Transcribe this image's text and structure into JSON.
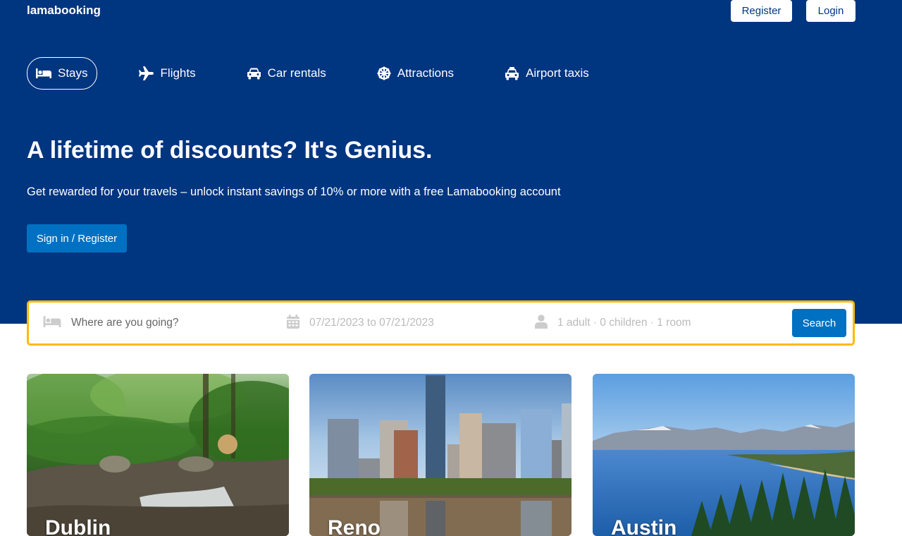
{
  "app": {
    "logo": "lamabooking"
  },
  "nav": {
    "register_label": "Register",
    "login_label": "Login"
  },
  "tabs": [
    {
      "label": "Stays",
      "icon": "bed-icon",
      "active": true
    },
    {
      "label": "Flights",
      "icon": "plane-icon",
      "active": false
    },
    {
      "label": "Car rentals",
      "icon": "car-icon",
      "active": false
    },
    {
      "label": "Attractions",
      "icon": "attraction-icon",
      "active": false
    },
    {
      "label": "Airport taxis",
      "icon": "taxi-icon",
      "active": false
    }
  ],
  "hero": {
    "title": "A lifetime of discounts? It's Genius.",
    "description": "Get rewarded for your travels – unlock instant savings of 10% or more with a free Lamabooking account",
    "cta_label": "Sign in / Register"
  },
  "search": {
    "destination_placeholder": "Where are you going?",
    "date_range": "07/21/2023 to 07/21/2023",
    "options": "1 adult · 0 children · 1 room",
    "button_label": "Search"
  },
  "featured": [
    {
      "title": "Dublin",
      "icon": "forest-waterfall-image"
    },
    {
      "title": "Reno",
      "icon": "city-skyline-image"
    },
    {
      "title": "Austin",
      "icon": "lake-mountains-image"
    }
  ],
  "colors": {
    "header_bg": "#003580",
    "primary": "#0071c2",
    "search_border": "#febb02"
  }
}
